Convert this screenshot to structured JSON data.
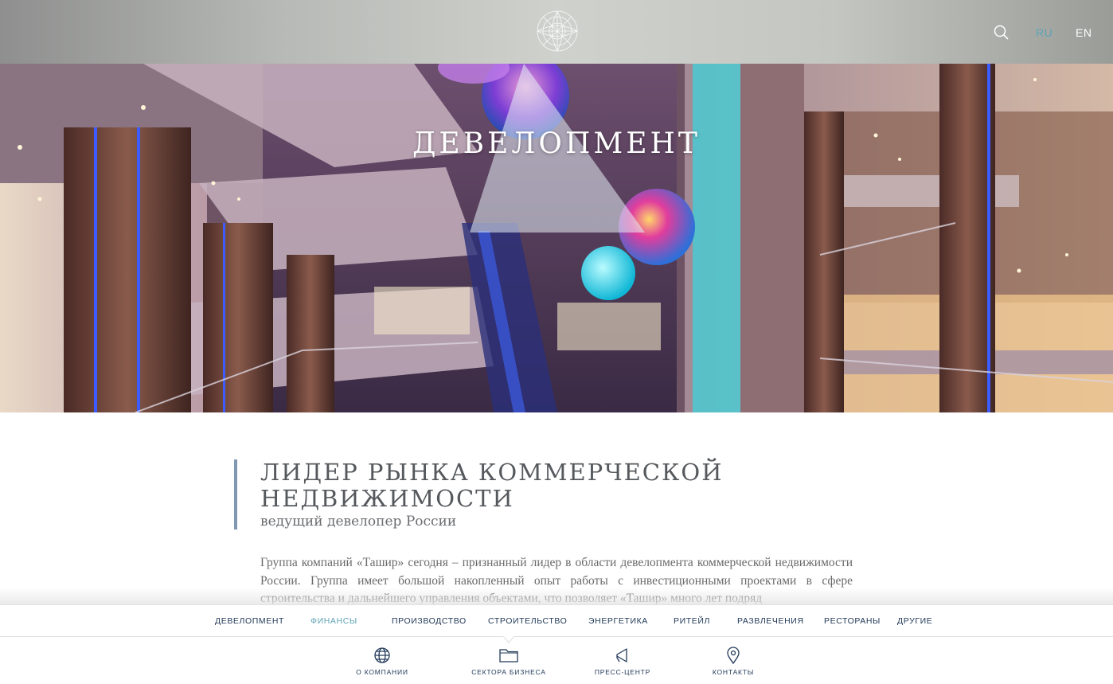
{
  "header": {
    "languages": [
      {
        "code": "RU",
        "active": true
      },
      {
        "code": "EN",
        "active": false
      }
    ],
    "accent_color": "#5fa3b6"
  },
  "hero": {
    "title": "ДЕВЕЛОПМЕНТ"
  },
  "content": {
    "heading": "ЛИДЕР РЫНКА КОММЕРЧЕСКОЙ НЕДВИЖИМОСТИ",
    "subheading": "ведущий девелопер России",
    "paragraph": "Группа компаний «Ташир» сегодня – признанный лидер в области девелопмента коммерческой недвижимости России. Группа имеет большой накопленный опыт работы с инвестиционными проектами в сфере строительства и дальнейшего управления объектами, что позволяет «Ташир» много лет подряд"
  },
  "sector_nav": {
    "items": [
      {
        "label": "ДЕВЕЛОПМЕНТ",
        "active": false
      },
      {
        "label": "ФИНАНСЫ",
        "active": true
      },
      {
        "label": "ПРОИЗВОДСТВО",
        "active": false
      },
      {
        "label": "СТРОИТЕЛЬСТВО",
        "active": false
      },
      {
        "label": "ЭНЕРГЕТИКА",
        "active": false
      },
      {
        "label": "РИТЕЙЛ",
        "active": false
      },
      {
        "label": "РАЗВЛЕЧЕНИЯ",
        "active": false
      },
      {
        "label": "РЕСТОРАНЫ",
        "active": false
      },
      {
        "label": "ДРУГИЕ",
        "active": false
      }
    ]
  },
  "bottom_nav": {
    "items": [
      {
        "label": "О КОМПАНИИ",
        "icon": "globe-icon"
      },
      {
        "label": "СЕКТОРА БИЗНЕСА",
        "icon": "folder-icon"
      },
      {
        "label": "ПРЕСС-ЦЕНТР",
        "icon": "megaphone-icon"
      },
      {
        "label": "КОНТАКТЫ",
        "icon": "location-pin-icon"
      }
    ],
    "text_color": "#223a58"
  }
}
